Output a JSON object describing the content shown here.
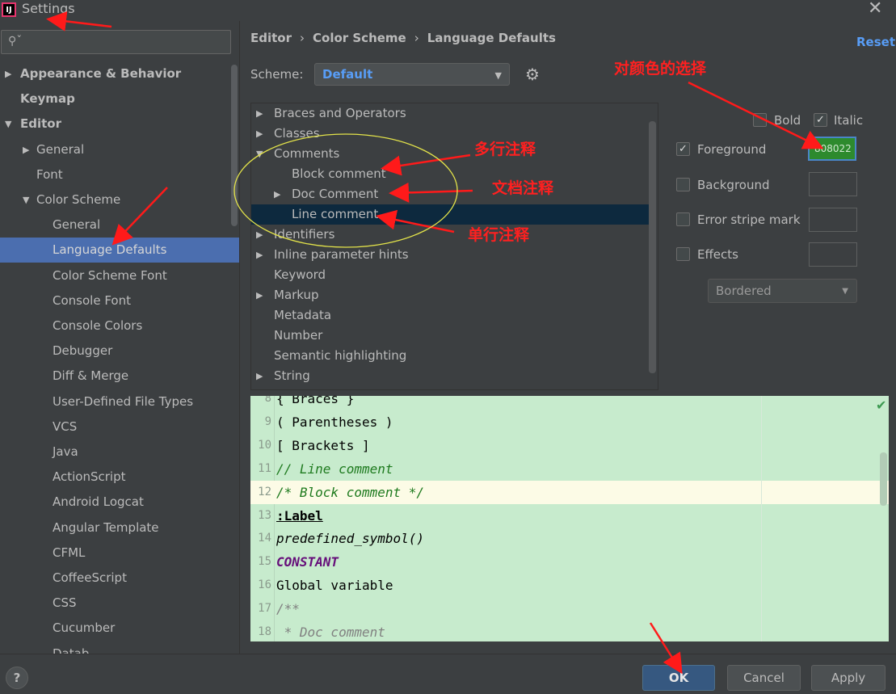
{
  "window": {
    "title": "Settings",
    "app_icon": "IJ"
  },
  "search": {
    "placeholder": ""
  },
  "sidebar": {
    "items": [
      {
        "label": "Appearance & Behavior",
        "arrow": "▶"
      },
      {
        "label": "Keymap",
        "arrow": ""
      },
      {
        "label": "Editor",
        "arrow": "▼"
      },
      {
        "label": "General",
        "arrow": "▶"
      },
      {
        "label": "Font",
        "arrow": ""
      },
      {
        "label": "Color Scheme",
        "arrow": "▼"
      },
      {
        "label": "General",
        "arrow": ""
      },
      {
        "label": "Language Defaults",
        "arrow": ""
      },
      {
        "label": "Color Scheme Font",
        "arrow": ""
      },
      {
        "label": "Console Font",
        "arrow": ""
      },
      {
        "label": "Console Colors",
        "arrow": ""
      },
      {
        "label": "Debugger",
        "arrow": ""
      },
      {
        "label": "Diff & Merge",
        "arrow": ""
      },
      {
        "label": "User-Defined File Types",
        "arrow": ""
      },
      {
        "label": "VCS",
        "arrow": ""
      },
      {
        "label": "Java",
        "arrow": ""
      },
      {
        "label": "ActionScript",
        "arrow": ""
      },
      {
        "label": "Android Logcat",
        "arrow": ""
      },
      {
        "label": "Angular Template",
        "arrow": ""
      },
      {
        "label": "CFML",
        "arrow": ""
      },
      {
        "label": "CoffeeScript",
        "arrow": ""
      },
      {
        "label": "CSS",
        "arrow": ""
      },
      {
        "label": "Cucumber",
        "arrow": ""
      },
      {
        "label": "Datab",
        "arrow": ""
      }
    ]
  },
  "breadcrumb": {
    "parts": [
      "Editor",
      "Color Scheme",
      "Language Defaults"
    ],
    "separator": "›"
  },
  "reset_label": "Reset",
  "scheme": {
    "label": "Scheme:",
    "value": "Default"
  },
  "tree": {
    "items": [
      {
        "label": "Braces and Operators",
        "arrow": "▶"
      },
      {
        "label": "Classes",
        "arrow": "▶"
      },
      {
        "label": "Comments",
        "arrow": "▼"
      },
      {
        "label": "Block comment",
        "arrow": ""
      },
      {
        "label": "Doc Comment",
        "arrow": "▶"
      },
      {
        "label": "Line comment",
        "arrow": ""
      },
      {
        "label": "Identifiers",
        "arrow": "▶"
      },
      {
        "label": "Inline parameter hints",
        "arrow": "▶"
      },
      {
        "label": "Keyword",
        "arrow": ""
      },
      {
        "label": "Markup",
        "arrow": "▶"
      },
      {
        "label": "Metadata",
        "arrow": ""
      },
      {
        "label": "Number",
        "arrow": ""
      },
      {
        "label": "Semantic highlighting",
        "arrow": ""
      },
      {
        "label": "String",
        "arrow": "▶"
      }
    ]
  },
  "attributes": {
    "bold": {
      "label": "Bold",
      "checked": false
    },
    "italic": {
      "label": "Italic",
      "checked": true
    },
    "foreground": {
      "label": "Foreground",
      "checked": true,
      "value": "808022",
      "color": "#2d8a2d"
    },
    "background": {
      "label": "Background",
      "checked": false
    },
    "error_stripe": {
      "label": "Error stripe mark",
      "checked": false
    },
    "effects": {
      "label": "Effects",
      "checked": false
    },
    "effect_type": "Bordered"
  },
  "editor": {
    "lines": [
      {
        "num": "8",
        "text": "{ Braces }",
        "style": "plain"
      },
      {
        "num": "9",
        "text": "( Parentheses )",
        "style": "plain"
      },
      {
        "num": "10",
        "text": "[ Brackets ]",
        "style": "plain"
      },
      {
        "num": "11",
        "text": "// Line comment",
        "style": "linecomment"
      },
      {
        "num": "12",
        "text": "/* Block comment */",
        "style": "blockcomment"
      },
      {
        "num": "13",
        "text": ":Label",
        "style": "label"
      },
      {
        "num": "14",
        "text": "predefined_symbol()",
        "style": "predef"
      },
      {
        "num": "15",
        "text": "CONSTANT",
        "style": "constant"
      },
      {
        "num": "16",
        "text": "Global variable",
        "style": "plain"
      },
      {
        "num": "17",
        "text": "/**",
        "style": "doc"
      },
      {
        "num": "18",
        "text": " * Doc comment",
        "style": "doc"
      }
    ],
    "colors": {
      "comment": "#1e7a1e",
      "doc": "#808080",
      "constant": "#660e7a"
    }
  },
  "annotations": {
    "color_choice": "对颜色的选择",
    "block": "多行注释",
    "doc": "文档注释",
    "line": "单行注释"
  },
  "buttons": {
    "help": "?",
    "ok": "OK",
    "cancel": "Cancel",
    "apply": "Apply"
  }
}
